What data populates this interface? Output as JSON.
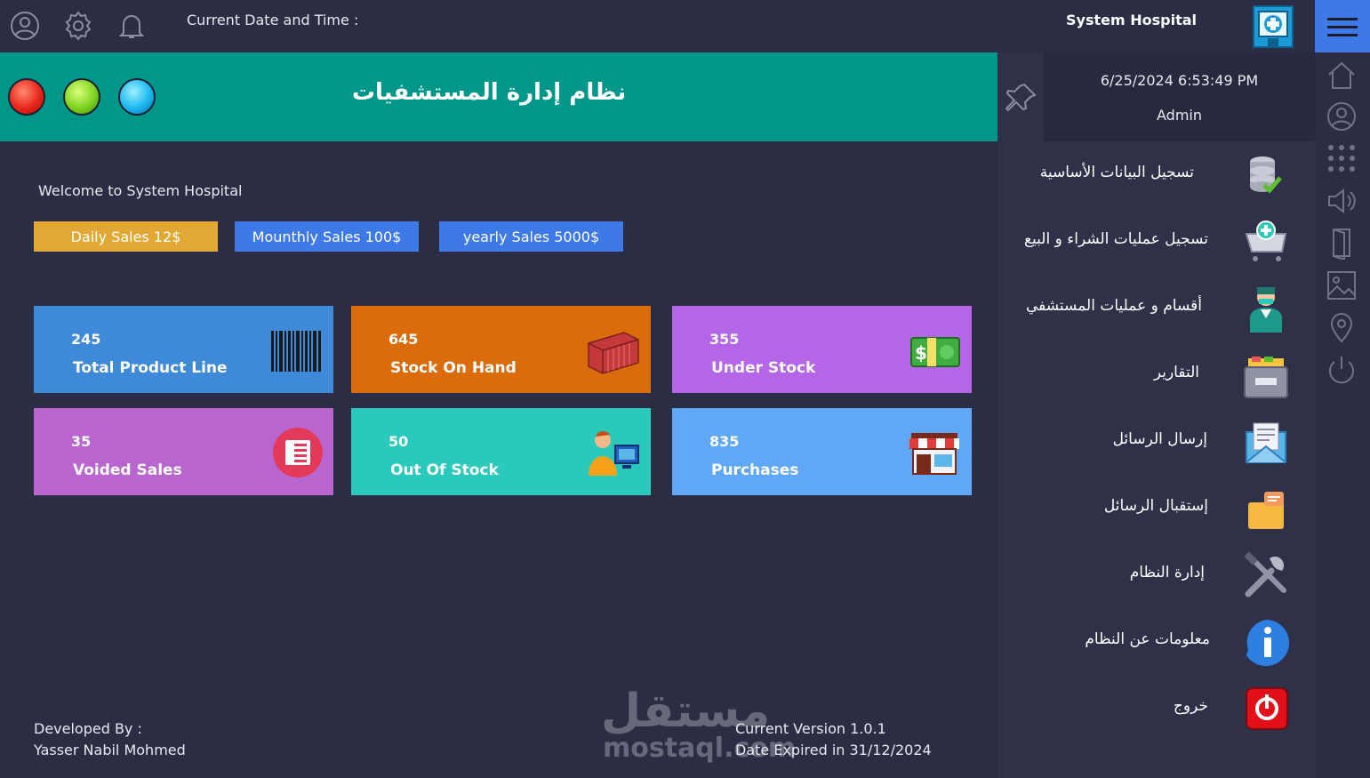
{
  "topbar": {
    "datetime_label": "Current Date and Time :",
    "app_title": "System Hospital",
    "icons": [
      "user-circle-icon",
      "gear-icon",
      "bell-icon",
      "hospital-icon",
      "hamburger-menu-icon"
    ]
  },
  "banner": {
    "title": "نظام إدارة المستشفيات",
    "dots": [
      "red",
      "green",
      "blue"
    ]
  },
  "user_box": {
    "datetime": "6/25/2024 6:53:49 PM",
    "user": "Admin"
  },
  "menu": [
    {
      "label": "تسجيل البيانات الأساسية",
      "icon": "database-check-icon"
    },
    {
      "label": "تسجيل عمليات الشراء و البيع",
      "icon": "shopping-cart-icon"
    },
    {
      "label": "أقسام و عمليات المستشفي",
      "icon": "doctor-icon"
    },
    {
      "label": "التقارير",
      "icon": "file-drawer-icon"
    },
    {
      "label": "إرسال الرسائل",
      "icon": "mail-icon"
    },
    {
      "label": "إستقبال الرسائل",
      "icon": "inbox-folder-icon"
    },
    {
      "label": "إدارة النظام",
      "icon": "tools-icon"
    },
    {
      "label": "معلومات عن النظام",
      "icon": "info-icon"
    },
    {
      "label": "خروج",
      "icon": "power-exit-icon"
    }
  ],
  "strip_icons": [
    "home-icon",
    "user-icon",
    "grid-dots-icon",
    "speaker-icon",
    "door-icon",
    "image-icon",
    "location-pin-icon",
    "power-icon"
  ],
  "content": {
    "welcome": "Welcome to System Hospital",
    "pills": {
      "daily": "Daily Sales 12$",
      "monthly": "Mounthly Sales 100$",
      "yearly": "yearly Sales 5000$"
    },
    "cards": [
      {
        "value": "245",
        "label": "Total Product Line",
        "color": "#3f89d9",
        "icon": "barcode-icon"
      },
      {
        "value": "645",
        "label": "Stock On Hand",
        "color": "#da6c0c",
        "icon": "container-icon"
      },
      {
        "value": "355",
        "label": "Under Stock",
        "color": "#b465e8",
        "icon": "money-icon"
      },
      {
        "value": "35",
        "label": "Voided Sales",
        "color": "#b865cf",
        "icon": "list-badge-icon"
      },
      {
        "value": "50",
        "label": "Out Of Stock",
        "color": "#2ac9bb",
        "icon": "user-computer-icon"
      },
      {
        "value": "835",
        "label": "Purchases",
        "color": "#60a8f5",
        "icon": "store-icon"
      }
    ]
  },
  "footer": {
    "dev_label": "Developed By :",
    "dev_name": "Yasser Nabil Mohmed",
    "version": "Current Version 1.0.1",
    "expiry": "Date Expired in 31/12/2024"
  },
  "watermark": {
    "arabic": "مستقل",
    "latin": "mostaql.com"
  },
  "colors": {
    "background": "#2a2d43",
    "banner": "#00978a",
    "accent_blue": "#3d7ae8",
    "accent_gold": "#e3a834"
  }
}
